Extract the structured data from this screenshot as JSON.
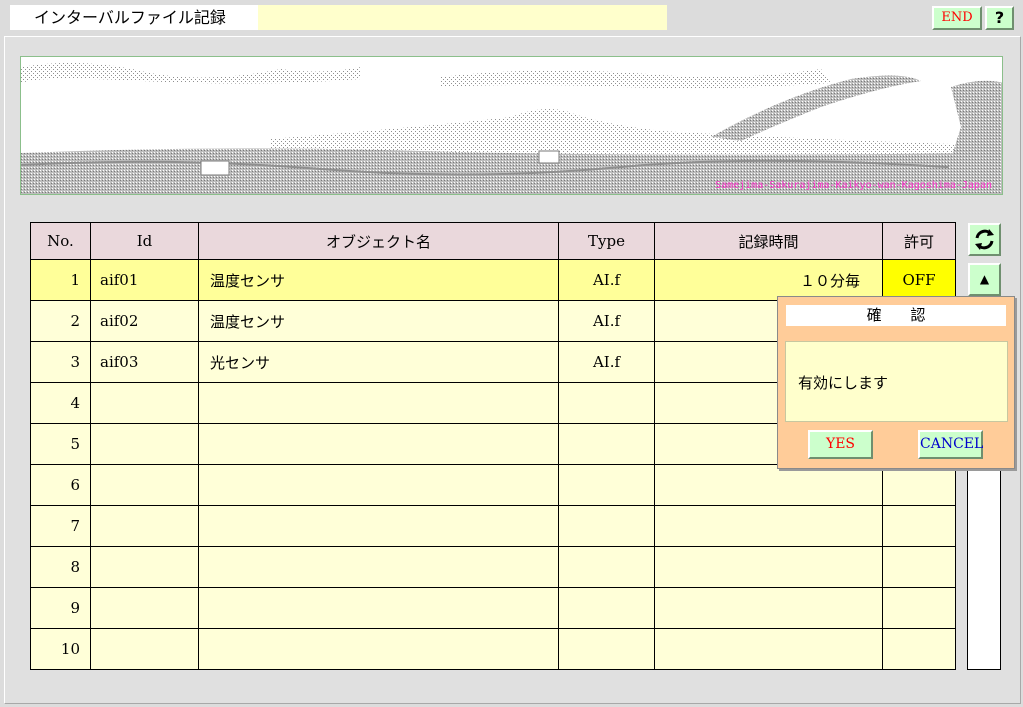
{
  "window": {
    "title": "インターバルファイル記録",
    "title_extra": ""
  },
  "toolbar": {
    "end_label": "END",
    "help_label": "?"
  },
  "banner": {
    "credit": "Samejima-Sakurajima-Kaikyo-wan-Kagoshima-Japan"
  },
  "table": {
    "headers": [
      "No.",
      "Id",
      "オブジェクト名",
      "Type",
      "記録時間",
      "許可"
    ],
    "rows": [
      {
        "no": "1",
        "id": "aif01",
        "name": "温度センサ",
        "type": "AI.f",
        "time": "１０分毎",
        "perm": "OFF"
      },
      {
        "no": "2",
        "id": "aif02",
        "name": "温度センサ",
        "type": "AI.f",
        "time": "",
        "perm": ""
      },
      {
        "no": "3",
        "id": "aif03",
        "name": "光センサ",
        "type": "AI.f",
        "time": "",
        "perm": ""
      },
      {
        "no": "4",
        "id": "",
        "name": "",
        "type": "",
        "time": "",
        "perm": ""
      },
      {
        "no": "5",
        "id": "",
        "name": "",
        "type": "",
        "time": "",
        "perm": ""
      },
      {
        "no": "6",
        "id": "",
        "name": "",
        "type": "",
        "time": "",
        "perm": ""
      },
      {
        "no": "7",
        "id": "",
        "name": "",
        "type": "",
        "time": "",
        "perm": ""
      },
      {
        "no": "8",
        "id": "",
        "name": "",
        "type": "",
        "time": "",
        "perm": ""
      },
      {
        "no": "9",
        "id": "",
        "name": "",
        "type": "",
        "time": "",
        "perm": ""
      },
      {
        "no": "10",
        "id": "",
        "name": "",
        "type": "",
        "time": "",
        "perm": ""
      }
    ]
  },
  "side": {
    "refresh_icon": "refresh-icon",
    "up_icon": "arrow-up-icon",
    "up_label": "▲"
  },
  "dialog": {
    "title": "確 認",
    "message": "有効にします",
    "yes_label": "YES",
    "cancel_label": "CANCEL"
  }
}
